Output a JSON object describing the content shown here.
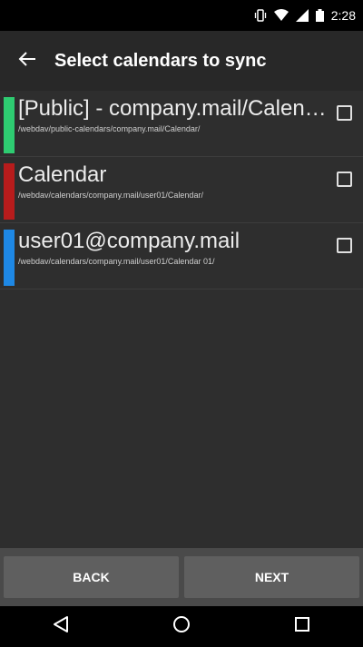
{
  "status_bar": {
    "time": "2:28",
    "icons": [
      "vibrate-icon",
      "wifi-icon",
      "signal-icon",
      "battery-icon"
    ]
  },
  "app_bar": {
    "title": "Select calendars to sync",
    "back_icon": "arrow-left-icon"
  },
  "calendars": [
    {
      "name": "[Public] - company.mail/Calen…",
      "path": "/webdav/public-calendars/company.mail/Calendar/",
      "color": "#2ecc71",
      "checked": false
    },
    {
      "name": "Calendar",
      "path": "/webdav/calendars/company.mail/user01/Calendar/",
      "color": "#b71c1c",
      "checked": false
    },
    {
      "name": "user01@company.mail",
      "path": "/webdav/calendars/company.mail/user01/Calendar 01/",
      "color": "#1e88e5",
      "checked": false
    }
  ],
  "buttons": {
    "back_label": "BACK",
    "next_label": "NEXT"
  },
  "nav_bar": {
    "icons": [
      "back-triangle-icon",
      "home-circle-icon",
      "recents-square-icon"
    ]
  }
}
